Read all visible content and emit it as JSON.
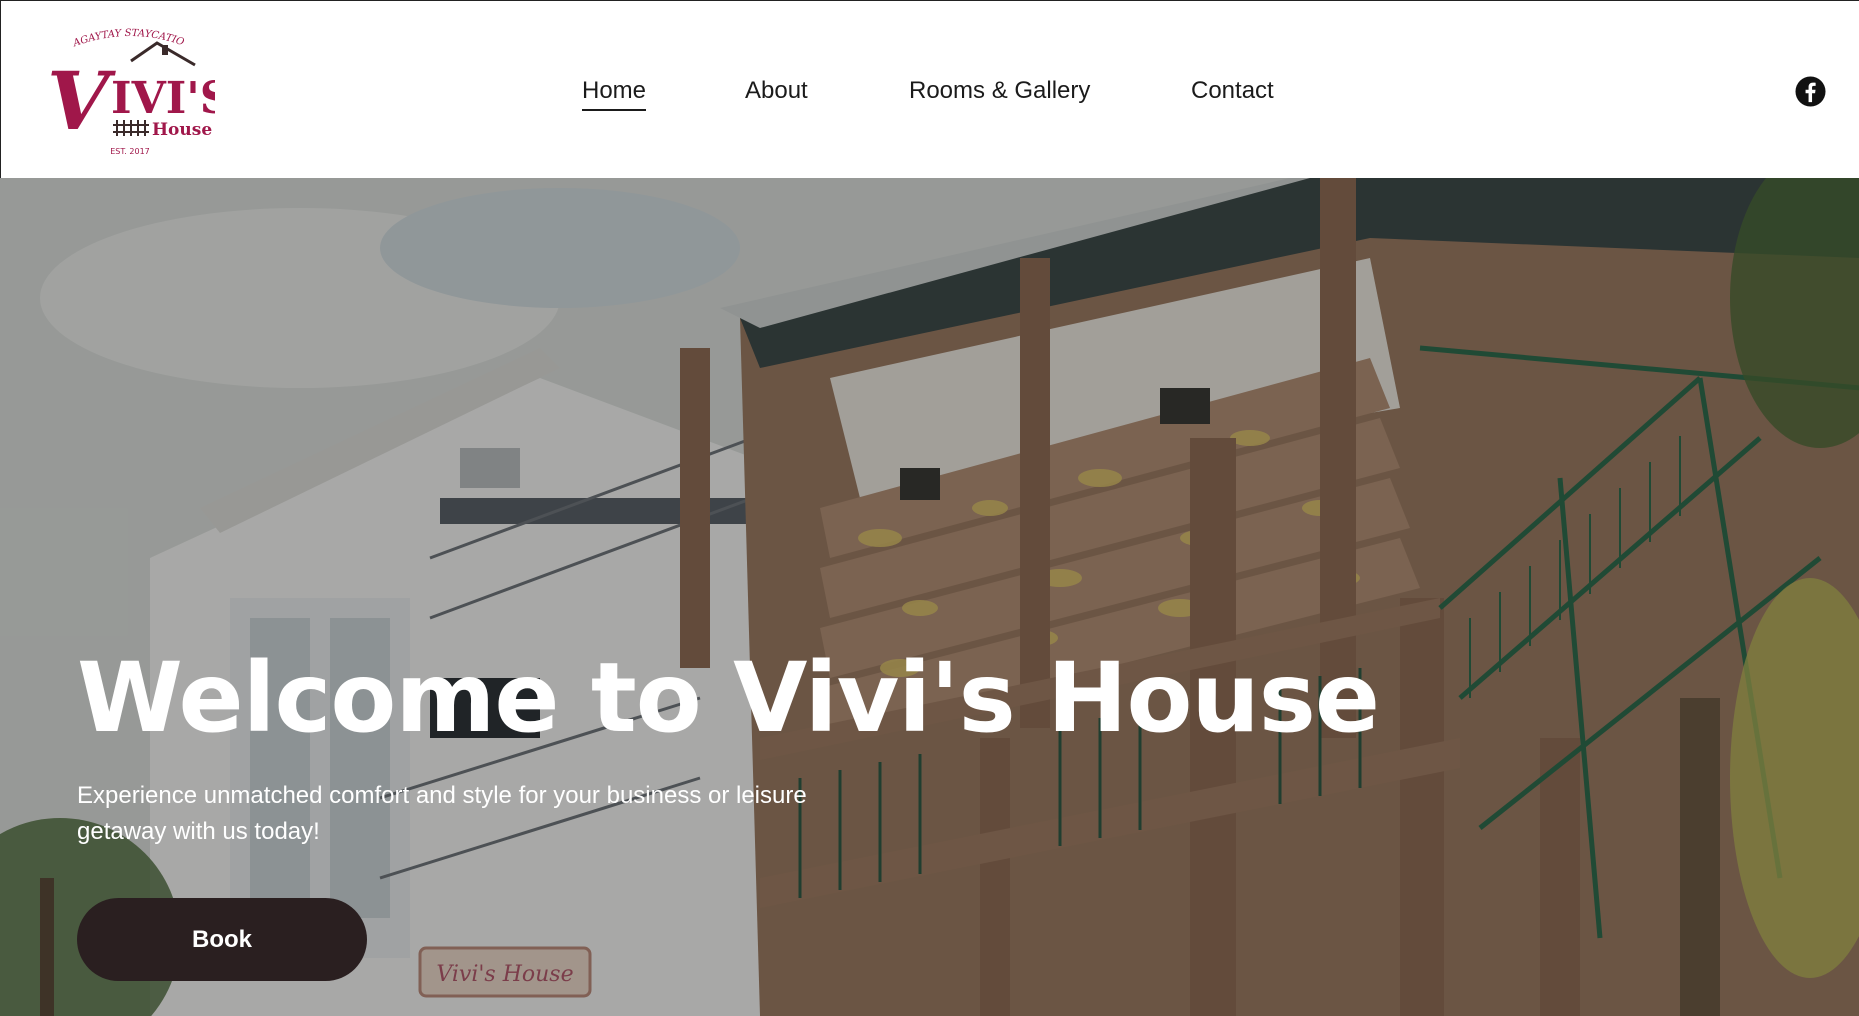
{
  "brand": {
    "tagline": "TAGAYTAY STAYCATION",
    "name": "VIVI'S",
    "name_suffix": "House",
    "established": "EST. 2017",
    "color": "#a0174a"
  },
  "nav": {
    "items": [
      {
        "label": "Home",
        "active": true
      },
      {
        "label": "About",
        "active": false
      },
      {
        "label": "Rooms & Gallery",
        "active": false
      },
      {
        "label": "Contact",
        "active": false
      }
    ],
    "social_icon": "facebook-icon"
  },
  "hero": {
    "title": "Welcome to Vivi's House",
    "subtitle": "Experience unmatched comfort and style for your business or leisure getaway with us today!",
    "button_label": "Book",
    "button_color": "#2a1f20",
    "photo_sign": "Vivi's House"
  }
}
